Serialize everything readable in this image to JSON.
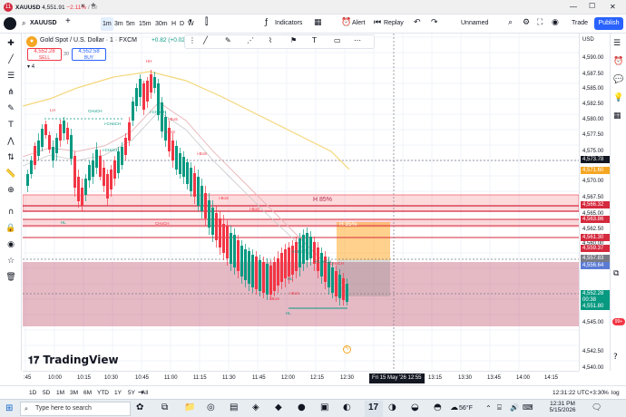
{
  "titlebar": {
    "tab_badge": "11",
    "tab_title": "XAUUSD",
    "tab_price": "4,551.91",
    "tab_change": "−2.11%",
    "tab_suffix": "/ Ur",
    "tab_close": "×",
    "new_tab": "+",
    "win_min": "—",
    "win_max": "☐",
    "win_close": "✕"
  },
  "toolbar": {
    "user_initial": "",
    "symbol": "XAUUSD",
    "add": "+",
    "intervals": [
      "1m",
      "3m",
      "5m",
      "15m",
      "30m",
      "H",
      "D",
      "W"
    ],
    "interval_more": "▾",
    "indicators": "Indicators",
    "alert": "Alert",
    "replay": "Replay",
    "layout_name": "Unnamed",
    "trade": "Trade",
    "publish": "Publish"
  },
  "legend": {
    "instrument": "Gold Spot / U.S. Dollar · 1 · FXCM",
    "change": "+0.82 (+0.02%)",
    "sell_price": "4,552.28",
    "sell_label": "SELL",
    "spread": "30",
    "buy_price": "4,552.58",
    "buy_label": "BUY",
    "count": "4"
  },
  "colors": {
    "up": "#089981",
    "down": "#f23645",
    "accent": "#2962ff",
    "zone_red": "#b2274a",
    "zone_orange": "#ff9800",
    "yellow_ma": "#f5d77a"
  },
  "chart": {
    "h_label_1": "H 85%",
    "h_label_2": "H 85%",
    "logo_text": "TradingView",
    "annotations": [
      {
        "t": "HH",
        "c": "#f23645"
      },
      {
        "t": "LH",
        "c": "#f23645"
      },
      {
        "t": "CHoCH",
        "c": "#089981"
      },
      {
        "t": "i-CHoCH",
        "c": "#089981"
      },
      {
        "t": "i-BoS",
        "c": "#f23645"
      },
      {
        "t": "i-BoS",
        "c": "#f23645"
      },
      {
        "t": "i-CHoCH",
        "c": "#089981"
      },
      {
        "t": "i-CHoCH",
        "c": "#089981"
      },
      {
        "t": "i-BoS",
        "c": "#f23645"
      },
      {
        "t": "HL",
        "c": "#089981"
      },
      {
        "t": "CHoCH",
        "c": "#f23645"
      },
      {
        "t": "i-BoS",
        "c": "#f23645"
      },
      {
        "t": "i-BoS",
        "c": "#f23645"
      },
      {
        "t": "i-CHoCH",
        "c": "#089981"
      },
      {
        "t": "HL",
        "c": "#089981"
      },
      {
        "t": "i-BoS",
        "c": "#f23645"
      },
      {
        "t": "i-BoS",
        "c": "#f23645"
      },
      {
        "t": "HL",
        "c": "#089981"
      },
      {
        "t": "i-CHoCH",
        "c": "#089981"
      },
      {
        "t": "i-CHoCH",
        "c": "#f23645"
      }
    ]
  },
  "price_axis": {
    "currency": "USD",
    "labels": [
      "4,590.00",
      "4,587.50",
      "4,585.00",
      "4,582.50",
      "4,580.00",
      "4,577.50",
      "4,575.00",
      "4,570.00",
      "4,567.50",
      "4,565.00",
      "4,562.50",
      "4,560.00",
      "4,545.00",
      "4,542.50",
      "4,540.00"
    ],
    "badges": [
      {
        "v": "4,573.78",
        "bg": "#131722"
      },
      {
        "v": "4,571.60",
        "bg": "#f5a623"
      },
      {
        "v": "4,566.32",
        "bg": "#d52a3e"
      },
      {
        "v": "4,563.86",
        "bg": "#d52a3e"
      },
      {
        "v": "4,561.30",
        "bg": "#d52a3e"
      },
      {
        "v": "4,559.37",
        "bg": "#d52a3e"
      },
      {
        "v": "4,557.83",
        "bg": "#787b86"
      },
      {
        "v": "4,556.64",
        "bg": "#5b7bd5"
      },
      {
        "v": "4,552.28",
        "bg": "#089981"
      },
      {
        "v": "00:38",
        "bg": "#089981"
      },
      {
        "v": "4,551.80",
        "bg": "#089981"
      }
    ]
  },
  "time_axis": {
    "labels": [
      ":45",
      "10:00",
      "10:15",
      "10:30",
      "10:45",
      "11:00",
      "11:15",
      "11:30",
      "11:45",
      "12:00",
      "12:15",
      "12:30",
      "12:55",
      "13:15",
      "13:30",
      "13:45",
      "14:00",
      "14:15"
    ],
    "cursor_time": "Fri 15 May '26"
  },
  "bottom": {
    "ranges": [
      "1D",
      "5D",
      "1M",
      "3M",
      "6M",
      "YTD",
      "1Y",
      "5Y",
      "All"
    ],
    "clock": "12:31:22 UTC+3:30",
    "pct": "%",
    "log": "log",
    "auto": "auto"
  },
  "taskbar": {
    "search": "Type here to search",
    "weather": "56°F",
    "time": "12:31 PM",
    "date": "5/15/2026"
  }
}
